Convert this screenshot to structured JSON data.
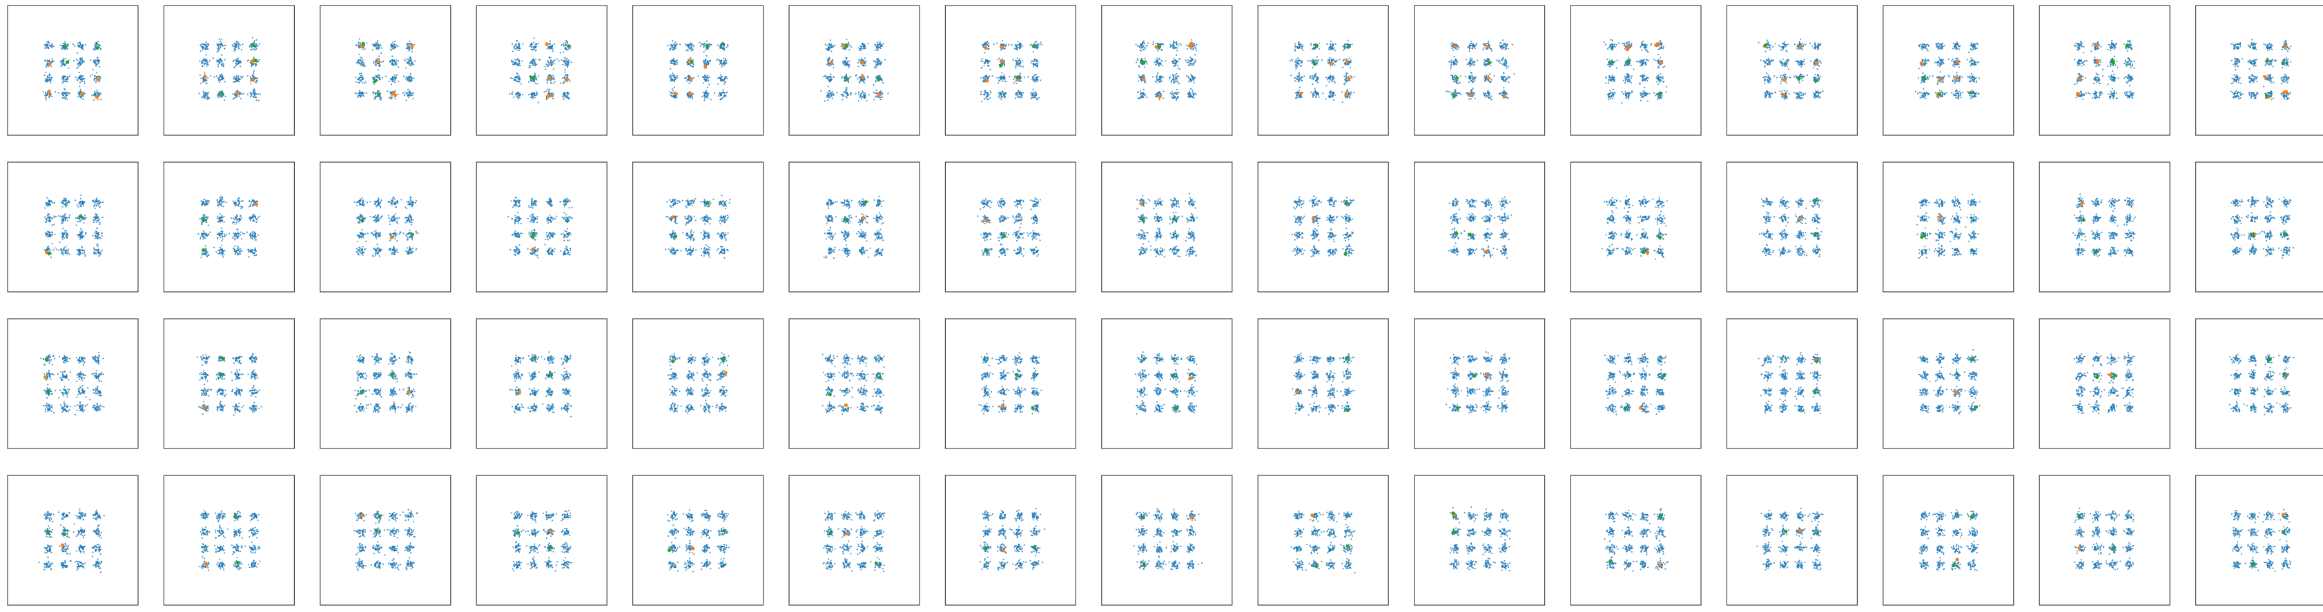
{
  "figure": {
    "rows": 4,
    "cols": 15,
    "background": "#ffffff",
    "frame_color": "#444444"
  },
  "chart_data": {
    "type": "scatter",
    "panel_count": 60,
    "axes_visible": false,
    "grid": false,
    "legend": "none",
    "xlim": [
      -8,
      8
    ],
    "ylim": [
      -8,
      8
    ],
    "mixture": {
      "kind": "4x4 grid of gaussian clusters",
      "grid_x": [
        -3,
        -1,
        1,
        3
      ],
      "grid_y": [
        -3,
        -1,
        1,
        3
      ],
      "cluster_std": 0.25
    },
    "series": [
      {
        "color": "#1f77b4",
        "role": "dense scattered samples"
      },
      {
        "color": "#ff7f0e",
        "role": "highlighted points"
      },
      {
        "color": "#2ca02c",
        "role": "highlighted points"
      }
    ]
  }
}
